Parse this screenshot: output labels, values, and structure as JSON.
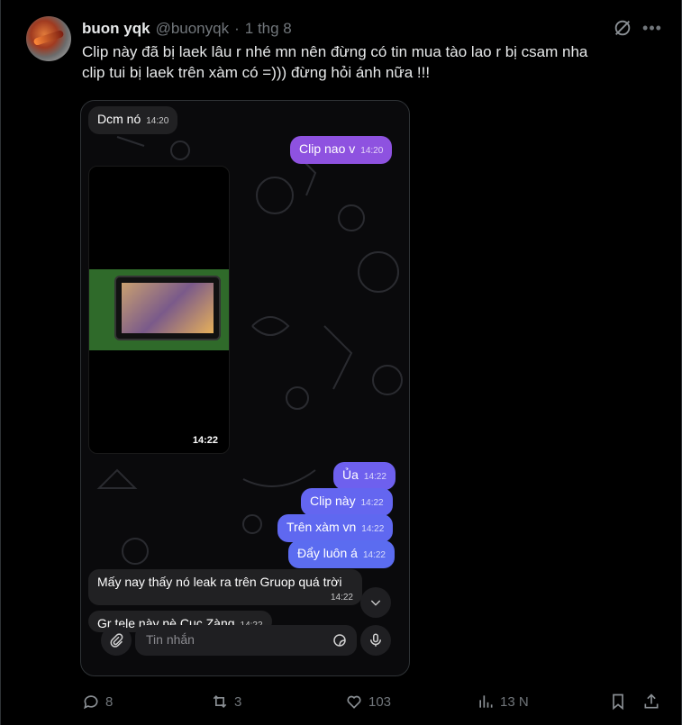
{
  "post": {
    "display_name": "buon yqk",
    "handle": "@buonyqk",
    "dot": "·",
    "date": "1 thg 8",
    "text_line1": "Clip này đã bị laek lâu r nhé mn nên đừng có tin mua tào lao r bị csam nha",
    "text_line2": "clip tui bị laek trên xàm có =))) đừng hỏi ánh nữa !!!"
  },
  "chat": {
    "msg1": {
      "text": "Dcm nó",
      "time": "14:20"
    },
    "msg2": {
      "text": "Clip nao v",
      "time": "14:20"
    },
    "video_time": "14:22",
    "msg3": {
      "text": "Ủa",
      "time": "14:22"
    },
    "msg4": {
      "text": "Clip này",
      "time": "14:22"
    },
    "msg5": {
      "text": "Trên xàm vn",
      "time": "14:22"
    },
    "msg6": {
      "text": "Đẩy luôn á",
      "time": "14:22"
    },
    "msg7": {
      "text": "Mấy nay thấy nó leak ra trên Gruop quá trời",
      "time": "14:22"
    },
    "msg8": {
      "text": "Gr tele này nè Cục Zàng",
      "time": "14:22"
    },
    "composer_placeholder": "Tin nhắn"
  },
  "actions": {
    "replies": "8",
    "reposts": "3",
    "likes": "103",
    "views": "13 N"
  },
  "icons": {
    "grok": "grok-icon",
    "more": "more-icon",
    "reply": "reply-icon",
    "repost": "repost-icon",
    "like": "heart-icon",
    "views": "analytics-icon",
    "bookmark": "bookmark-icon",
    "share": "share-icon"
  },
  "colors": {
    "out_bubble_top": "#8e52e0",
    "out_bubble_bottom": "#5b6cf0",
    "muted": "#71767b"
  }
}
